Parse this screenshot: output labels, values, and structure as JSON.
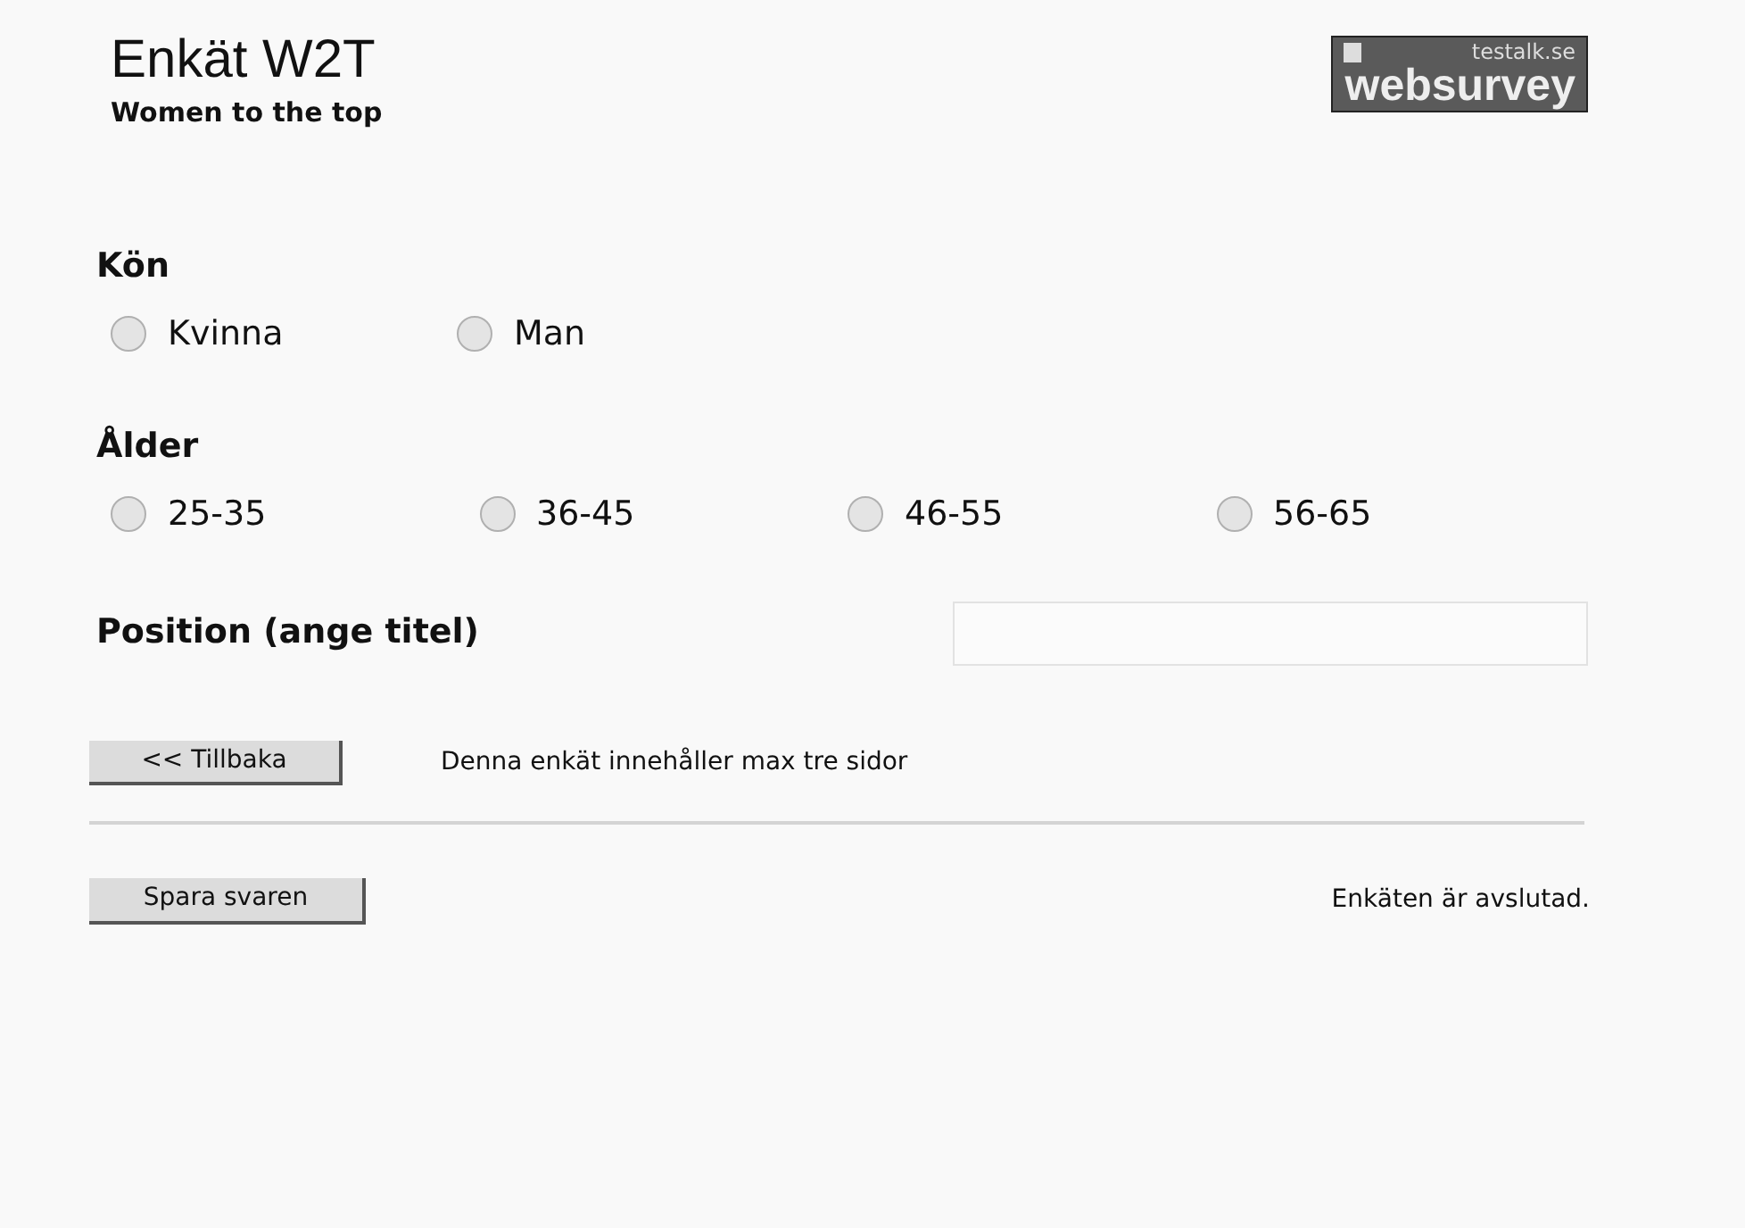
{
  "header": {
    "title": "Enkät W2T",
    "subtitle": "Women to the top",
    "logo": {
      "top_text": "testalk.se",
      "main_text": "websurvey"
    }
  },
  "questions": [
    {
      "kind": "radio",
      "label": "Kön",
      "options": [
        {
          "label": "Kvinna",
          "selected": false
        },
        {
          "label": "Man",
          "selected": false
        }
      ]
    },
    {
      "kind": "radio",
      "label": "Ålder",
      "options": [
        {
          "label": "25-35",
          "selected": false
        },
        {
          "label": "36-45",
          "selected": false
        },
        {
          "label": "46-55",
          "selected": false
        },
        {
          "label": "56-65",
          "selected": false
        }
      ]
    },
    {
      "kind": "text",
      "label": "Position (ange titel)"
    }
  ],
  "navigation": {
    "back_button": "<< Tillbaka",
    "note": "Denna enkät innehåller max tre sidor"
  },
  "footer": {
    "save_button": "Spara svaren",
    "status": "Enkäten är avslutad."
  }
}
